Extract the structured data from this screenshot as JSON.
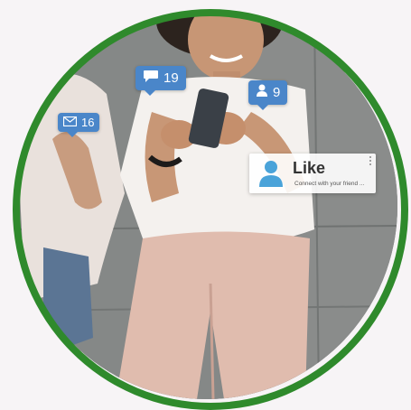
{
  "notifications": {
    "messages": {
      "icon": "speech-bubble-icon",
      "count": "19"
    },
    "users": {
      "icon": "user-icon",
      "count": "9"
    },
    "mail": {
      "icon": "envelope-icon",
      "count": "16"
    }
  },
  "like_card": {
    "icon": "user-silhouette-icon",
    "title": "Like",
    "subtitle": "Connect with your friend ..."
  },
  "colors": {
    "ring": "#2f8a2c",
    "badge": "#4a86c9",
    "like_icon": "#4aa3d9"
  }
}
